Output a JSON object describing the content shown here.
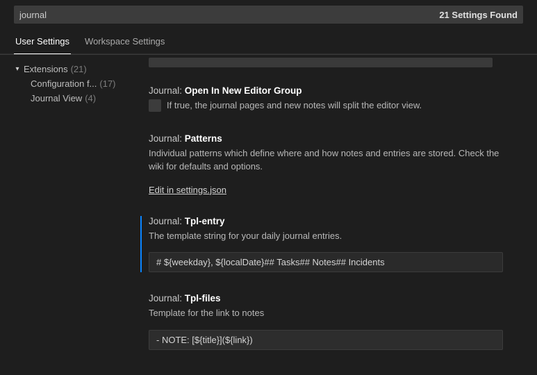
{
  "search": {
    "value": "journal",
    "results_label": "21 Settings Found"
  },
  "tabs": {
    "user": "User Settings",
    "workspace": "Workspace Settings"
  },
  "tree": {
    "extensions_label": "Extensions",
    "extensions_count": "(21)",
    "config_label": "Configuration f...",
    "config_count": "(17)",
    "journal_label": "Journal View",
    "journal_count": "(4)"
  },
  "settings": {
    "openNew": {
      "scope": "Journal:",
      "name": "Open In New Editor Group",
      "desc": "If true, the journal pages and new notes will split the editor view."
    },
    "patterns": {
      "scope": "Journal:",
      "name": "Patterns",
      "desc": "Individual patterns which define where and how notes and entries are stored. Check the wiki for defaults and options.",
      "link": "Edit in settings.json"
    },
    "tplEntry": {
      "scope": "Journal:",
      "name": "Tpl-entry",
      "desc": "The template string for your daily journal entries.",
      "value": "# ${weekday}, ${localDate}## Tasks## Notes## Incidents"
    },
    "tplFiles": {
      "scope": "Journal:",
      "name": "Tpl-files",
      "desc": "Template for the link to notes",
      "value": "- NOTE: [${title}](${link})"
    }
  }
}
